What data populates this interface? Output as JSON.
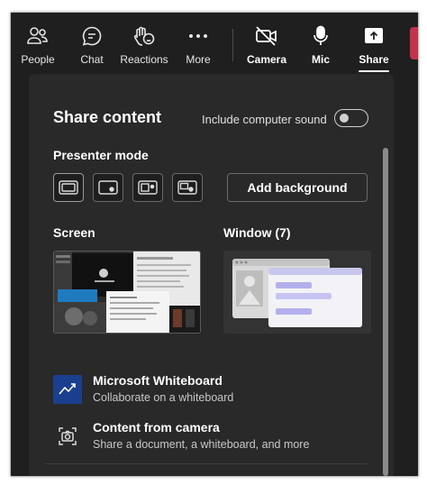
{
  "toolbar": {
    "people": "People",
    "chat": "Chat",
    "reactions": "Reactions",
    "more": "More",
    "camera": "Camera",
    "mic": "Mic",
    "share": "Share"
  },
  "panel": {
    "title": "Share content",
    "include_sound_label": "Include computer sound",
    "include_sound_on": false,
    "presenter_mode_label": "Presenter mode",
    "add_background_label": "Add background",
    "screen_label": "Screen",
    "window_label": "Window (7)",
    "items": [
      {
        "title": "Microsoft Whiteboard",
        "subtitle": "Collaborate on a whiteboard",
        "icon": "whiteboard-icon"
      },
      {
        "title": "Content from camera",
        "subtitle": "Share a document, a whiteboard, and more",
        "icon": "camera-content-icon"
      }
    ]
  },
  "colors": {
    "background": "#1f1f1f",
    "panel": "#292929",
    "accent": "#5b5fc7",
    "whiteboard_blue": "#1a3f8f",
    "leave_red": "#c4314b"
  }
}
